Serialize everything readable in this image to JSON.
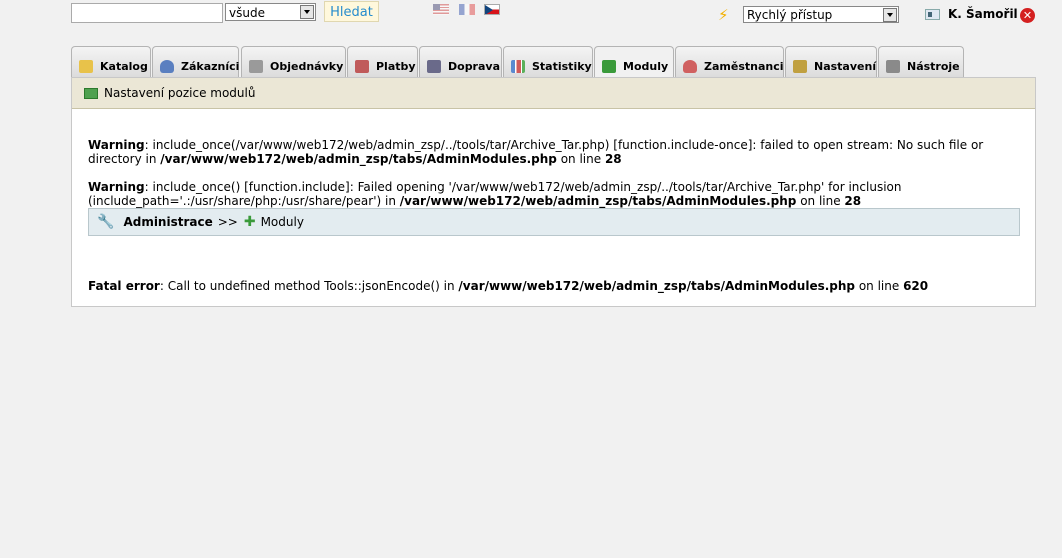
{
  "search": {
    "placeholder": "",
    "scope_selected": "všude",
    "button_label": "Hledat"
  },
  "languages": [
    "en",
    "fr",
    "cz"
  ],
  "quick_access": {
    "selected": "Rychlý přístup"
  },
  "user": {
    "name": "K. Šamořil"
  },
  "tabs": [
    {
      "label": "Katalog",
      "icon": "folder-icon",
      "color": "#e8c24a"
    },
    {
      "label": "Zákazníci",
      "icon": "customer-icon",
      "color": "#5a7fc0"
    },
    {
      "label": "Objednávky",
      "icon": "cart-icon",
      "color": "#9a9a9a"
    },
    {
      "label": "Platby",
      "icon": "payment-icon",
      "color": "#c05a5a"
    },
    {
      "label": "Doprava",
      "icon": "truck-icon",
      "color": "#6a6a8a"
    },
    {
      "label": "Statistiky",
      "icon": "chart-icon",
      "color": "#5a8ad0"
    },
    {
      "label": "Moduly",
      "icon": "puzzle-icon",
      "color": "#3a9a3a"
    },
    {
      "label": "Zaměstnanci",
      "icon": "employee-icon",
      "color": "#d06060"
    },
    {
      "label": "Nastavení",
      "icon": "settings-icon",
      "color": "#c0a040"
    },
    {
      "label": "Nástroje",
      "icon": "wrench-icon",
      "color": "#8a8a8a"
    }
  ],
  "active_tab": "Moduly",
  "panel": {
    "title": "Nastavení pozice modulů",
    "warning1": {
      "label": "Warning",
      "text": ": include_once(/var/www/web172/web/admin_zsp/../tools/tar/Archive_Tar.php) [function.include-once]: failed to open stream: No such file or directory in ",
      "file": "/var/www/web172/web/admin_zsp/tabs/AdminModules.php",
      "on_line": " on line ",
      "line": "28"
    },
    "warning2": {
      "label": "Warning",
      "text": ": include_once() [function.include]: Failed opening '/var/www/web172/web/admin_zsp/../tools/tar/Archive_Tar.php' for inclusion (include_path='.:/usr/share/php:/usr/share/pear') in ",
      "file": "/var/www/web172/web/admin_zsp/tabs/AdminModules.php",
      "on_line": " on line ",
      "line": "28"
    },
    "breadcrumb": {
      "root": "Administrace",
      "separator": ">>",
      "current": "Moduly"
    },
    "fatal": {
      "label": "Fatal error",
      "text": ": Call to undefined method Tools::jsonEncode() in ",
      "file": "/var/www/web172/web/admin_zsp/tabs/AdminModules.php",
      "on_line": " on line ",
      "line": "620"
    }
  }
}
